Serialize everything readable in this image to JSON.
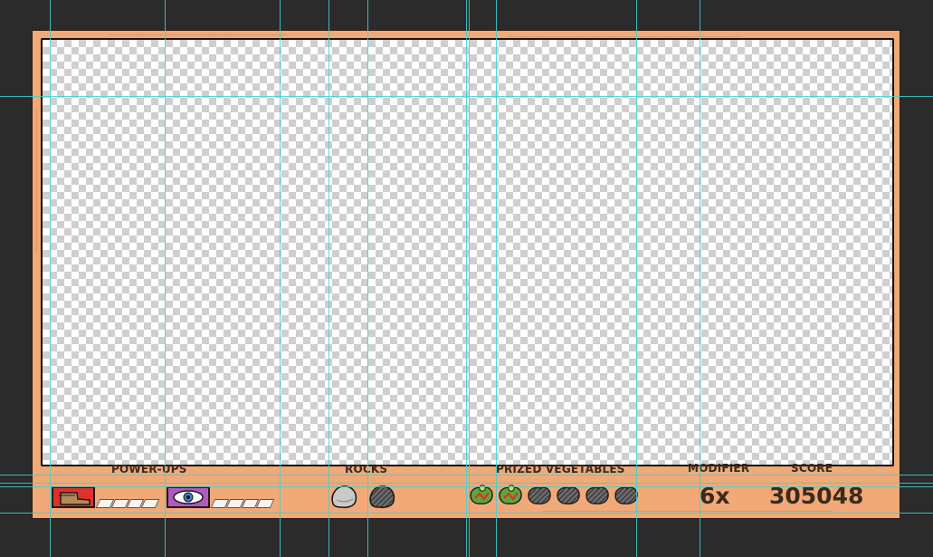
{
  "hud": {
    "powerups": {
      "label": "POWER-UPS",
      "items": [
        {
          "icon": "boot-icon",
          "color": "#e0302b",
          "charge_segments": 4,
          "filled_segments": 0
        },
        {
          "icon": "eye-icon",
          "color": "#b05ac0",
          "charge_segments": 4,
          "filled_segments": 0
        }
      ]
    },
    "rocks": {
      "label": "ROCKS",
      "items": [
        {
          "icon": "rock-icon",
          "state": "available"
        },
        {
          "icon": "rock-icon",
          "state": "used"
        }
      ]
    },
    "vegetables": {
      "label": "PRIZED VEGETABLES",
      "total": 6,
      "collected": 2
    },
    "modifier": {
      "label": "MODIFIER",
      "value": "6x"
    },
    "score": {
      "label": "SCORE",
      "value": "305048"
    }
  },
  "colors": {
    "frame": "#f1a977",
    "text": "#3b2a1f",
    "guide": "#3fd1d1"
  }
}
